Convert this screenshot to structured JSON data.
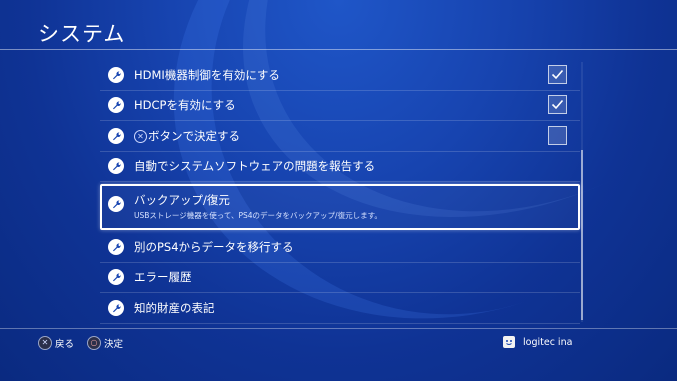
{
  "page": {
    "title": "システム"
  },
  "settings": {
    "items": [
      {
        "label": "HDMI機器制御を有効にする",
        "checkbox": true,
        "checked": true,
        "icon": "wrench-icon"
      },
      {
        "label": "HDCPを有効にする",
        "checkbox": true,
        "checked": true,
        "icon": "wrench-icon"
      },
      {
        "label": "ボタンで決定する",
        "prefix_symbol": "✕",
        "checkbox": true,
        "checked": false,
        "icon": "wrench-icon"
      },
      {
        "label": "自動でシステムソフトウェアの問題を報告する",
        "checkbox": false,
        "icon": "wrench-icon"
      },
      {
        "label": "バックアップ/復元",
        "description": "USBストレージ機器を使って、PS4のデータをバックアップ/復元します。",
        "selected": true,
        "icon": "wrench-icon"
      },
      {
        "label": "別のPS4からデータを移行する",
        "checkbox": false,
        "icon": "wrench-icon"
      },
      {
        "label": "エラー履歴",
        "checkbox": false,
        "icon": "wrench-icon"
      },
      {
        "label": "知的財産の表記",
        "checkbox": false,
        "icon": "wrench-icon"
      }
    ]
  },
  "footer": {
    "back_symbol": "✕",
    "back_label": "戻る",
    "confirm_symbol": "○",
    "confirm_label": "決定",
    "user_name": "logitec ina"
  },
  "colors": {
    "background": "#1744b0",
    "accent": "#ffffff"
  }
}
